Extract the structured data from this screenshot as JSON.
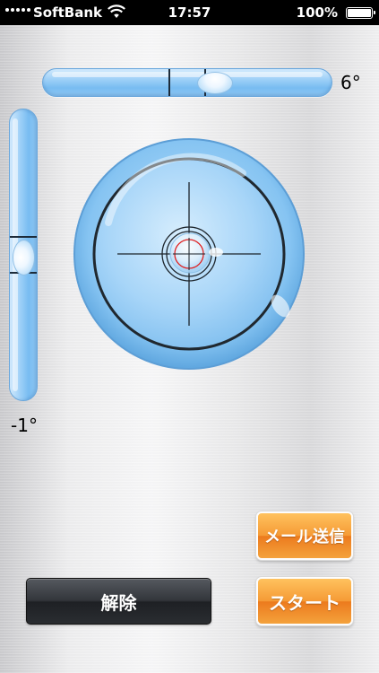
{
  "status_bar": {
    "carrier": "SoftBank",
    "time": "17:57",
    "battery": "100%"
  },
  "level": {
    "horizontal_angle": "6°",
    "vertical_angle": "-1°"
  },
  "buttons": {
    "mail": "メール送信",
    "start": "スタート",
    "release": "解除"
  },
  "colors": {
    "bubble_tube": "#8cc8f5",
    "button_orange": "#f0902a",
    "button_dark": "#2a2d31",
    "target_red": "#e02020"
  }
}
